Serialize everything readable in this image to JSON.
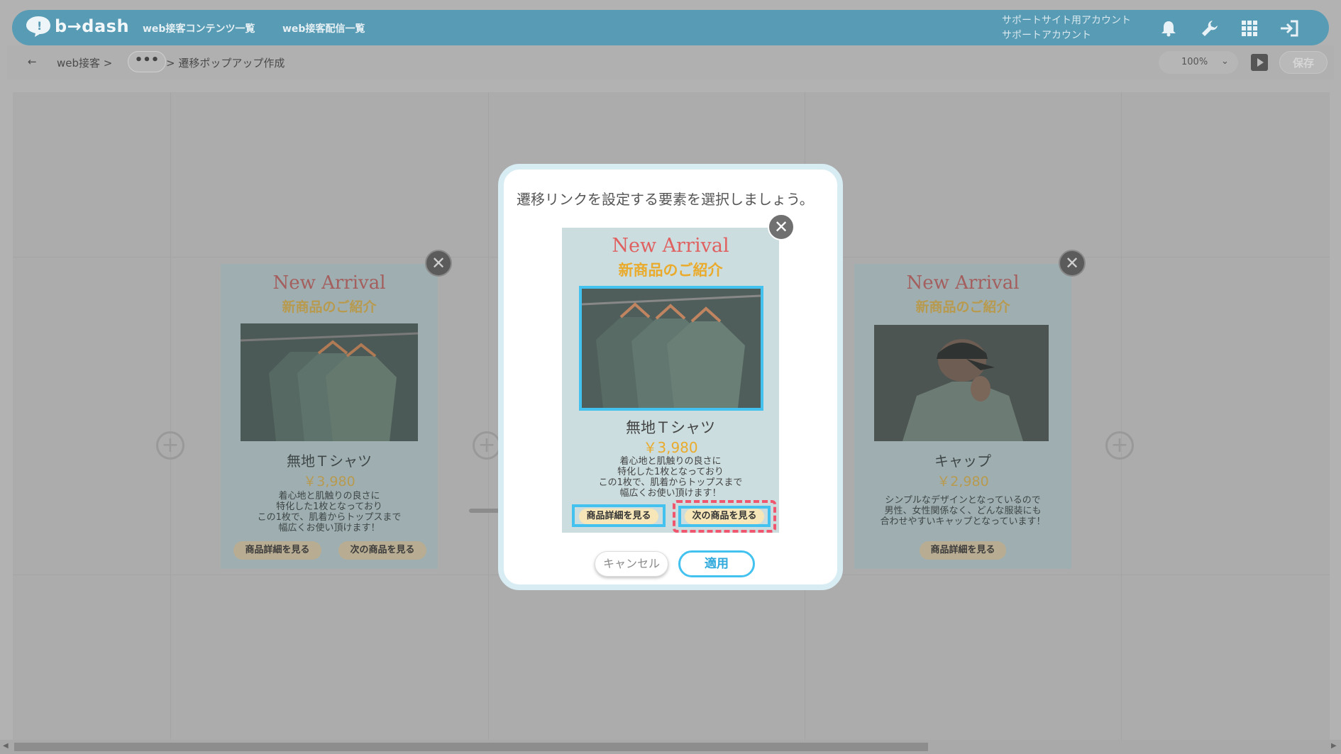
{
  "header": {
    "logo_text": "b→dash",
    "nav": [
      "web接客コンテンツ一覧",
      "web接客配信一覧"
    ],
    "account_line1": "サポートサイト用アカウント",
    "account_line2": "サポートアカウント",
    "icons": [
      "bell-icon",
      "wrench-icon",
      "apps-grid-icon",
      "logout-icon"
    ]
  },
  "breadcrumb": {
    "back": "←",
    "root": "web接客 >",
    "more": "•••",
    "current": "> 遷移ポップアップ作成"
  },
  "toolbar": {
    "zoom": "100%",
    "save_label": "保存"
  },
  "cards": [
    {
      "title": "New Arrival",
      "subtitle": "新商品のご紹介",
      "name": "無地Ｔシャツ",
      "price": "￥3,980",
      "desc": [
        "着心地と肌触りの良さに",
        "特化した1枚となっており",
        "この1枚で、肌着からトップスまで",
        "幅広くお使い頂けます！"
      ],
      "btn1": "商品詳細を見る",
      "btn2": "次の商品を見る"
    },
    {
      "title": "New Arrival",
      "subtitle": "新商品のご紹介",
      "name": "キャップ",
      "price": "￥2,980",
      "desc": [
        "シンプルなデザインとなっているので",
        "男性、女性関係なく、どんな服装にも",
        "合わせやすいキャップとなっています！"
      ],
      "btn1": "商品詳細を見る"
    }
  ],
  "modal": {
    "title": "遷移リンクを設定する要素を選択しましょう。",
    "preview": {
      "title": "New Arrival",
      "subtitle": "新商品のご紹介",
      "name": "無地Ｔシャツ",
      "price": "￥3,980",
      "desc": [
        "着心地と肌触りの良さに",
        "特化した1枚となっており",
        "この1枚で、肌着からトップスまで",
        "幅広くお使い頂けます！"
      ],
      "btn1": "商品詳細を見る",
      "btn2": "次の商品を見る"
    },
    "cancel_label": "キャンセル",
    "apply_label": "適用"
  },
  "colors": {
    "header": "#589bb4",
    "accent": "#43c2ef",
    "selected_dashed": "#f0566e"
  }
}
